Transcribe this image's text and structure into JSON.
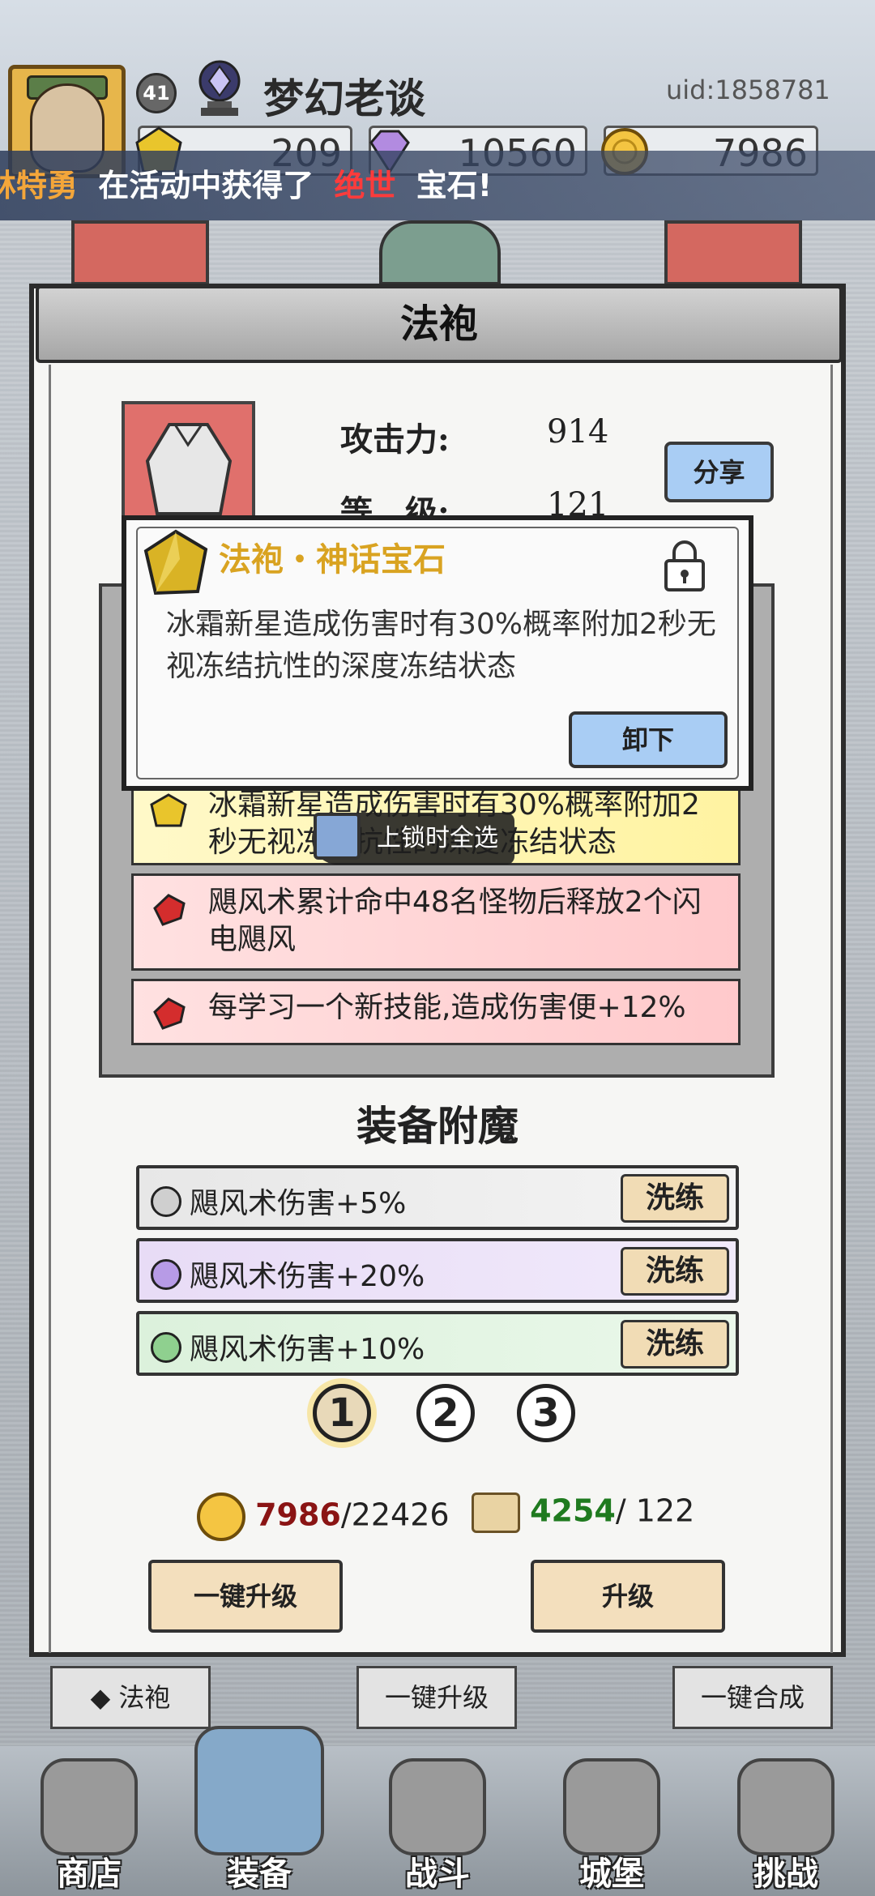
{
  "player": {
    "level": "41",
    "name": "梦幻老谈",
    "uid": "uid:1858781"
  },
  "resources": [
    {
      "name": "gold-gem",
      "value": "209"
    },
    {
      "name": "purple-gem",
      "value": "10560"
    },
    {
      "name": "coin",
      "value": "7986"
    }
  ],
  "ticker": {
    "player": "林特勇",
    "mid": "在活动中获得了",
    "rarity": "绝世",
    "tail": "宝石!"
  },
  "modal": {
    "title": "法袍",
    "stats": [
      {
        "label": "攻击力:",
        "value": "914"
      },
      {
        "label": "等　级:",
        "value": "121"
      }
    ],
    "share_label": "分享"
  },
  "gem_rows": [
    {
      "text": "冰霜新星造成伤害时有30%概率附加2秒无视冻结抗性的深度冻结状态",
      "color": "yellow"
    },
    {
      "text": "飓风术累计命中48名怪物后释放2个闪电飓风",
      "color": "pink"
    },
    {
      "text": "每学习一个新技能,造成伤害便+12%",
      "color": "pink"
    }
  ],
  "lock_all_label": "上锁时全选",
  "popup": {
    "title": "法袍・神话宝石",
    "desc": "冰霜新星造成伤害时有30%概率附加2秒无视冻结抗性的深度冻结状态",
    "unequip_label": "卸下"
  },
  "enchant": {
    "title": "装备附魔",
    "rows": [
      {
        "text": "飓风术伤害+5%",
        "color": "#cfcfcf",
        "reroll": "洗练"
      },
      {
        "text": "飓风术伤害+20%",
        "color": "#b79be6",
        "reroll": "洗练"
      },
      {
        "text": "飓风术伤害+10%",
        "color": "#8fd08f",
        "reroll": "洗练"
      }
    ],
    "pages": [
      "1",
      "2",
      "3"
    ],
    "active_page": "1"
  },
  "cost": {
    "coin_have": "7986",
    "coin_need": "22426",
    "scroll_have": "4254",
    "scroll_need": "122"
  },
  "buttons": {
    "one_click_upgrade": "一键升级",
    "upgrade": "升级"
  },
  "sub_tabs": [
    {
      "label": "法袍"
    },
    {
      "label": "一键升级"
    },
    {
      "label": "一键合成"
    }
  ],
  "nav": [
    {
      "label": "商店"
    },
    {
      "label": "装备"
    },
    {
      "label": "战斗"
    },
    {
      "label": "城堡"
    },
    {
      "label": "挑战"
    }
  ],
  "colors": {
    "gold_text": "#d9a321",
    "button_blue": "#a9cdf4",
    "button_tan": "#f3dfbd"
  }
}
